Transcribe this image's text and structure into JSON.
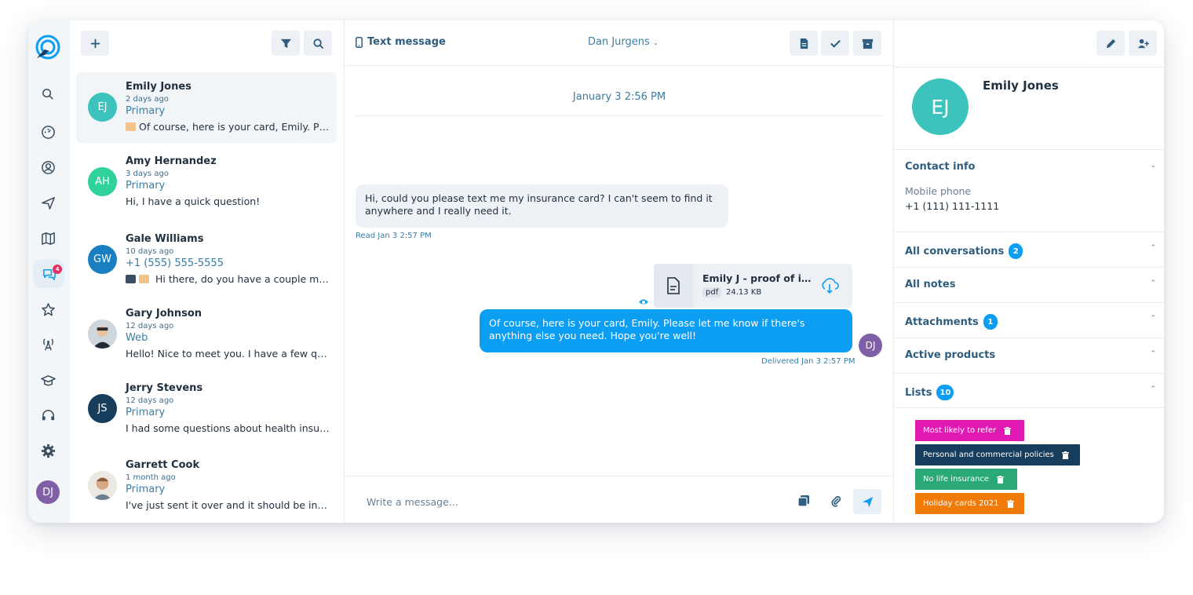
{
  "rail": {
    "items": [
      {
        "icon": "search-icon"
      },
      {
        "icon": "dashboard-icon"
      },
      {
        "icon": "contact-icon"
      },
      {
        "icon": "send-icon"
      },
      {
        "icon": "map-icon"
      },
      {
        "icon": "chat-icon",
        "badge": "4"
      },
      {
        "icon": "star-icon"
      },
      {
        "icon": "broadcast-icon"
      },
      {
        "icon": "graduation-cap-icon"
      },
      {
        "icon": "headset-icon"
      },
      {
        "icon": "gear-icon"
      }
    ],
    "user_initials": "DJ"
  },
  "conversations": [
    {
      "name": "Emily Jones",
      "initials": "EJ",
      "color": "#3cc3bd",
      "time": "2 days ago",
      "channel": "Primary",
      "preview": "Of course, here is your card, Emily. Please let me know if there's anything else you need."
    },
    {
      "name": "Amy Hernandez",
      "initials": "AH",
      "color": "#2fd39a",
      "time": "3 days ago",
      "channel": "Primary",
      "preview": "Hi, I have a quick question!"
    },
    {
      "name": "Gale Williams",
      "initials": "GW",
      "color": "#1a7fc1",
      "time": "10 days ago",
      "channel": "+1 (555) 555-5555",
      "preview": "Hi there, do you have a couple minutes to talk?"
    },
    {
      "name": "Gary Johnson",
      "initials": "",
      "color": "#8a96a3",
      "time": "12 days ago",
      "channel": "Web",
      "preview": "Hello! Nice to meet you. I have a few  questions about my policy."
    },
    {
      "name": "Jerry Stevens",
      "initials": "JS",
      "color": "#163d5c",
      "time": "12 days ago",
      "channel": "Primary",
      "preview": "I had some questions about health insurance coverage."
    },
    {
      "name": "Garrett Cook",
      "initials": "",
      "color": "#c89b7b",
      "time": "1 month ago",
      "channel": "Primary",
      "preview": "I've just sent it over and it should be in your inbox."
    }
  ],
  "chat": {
    "channel_label": "Text message",
    "agent": "Dan Jurgens",
    "date_separator": "January 3 2:56 PM",
    "incoming_text": "Hi, could you please text me my insurance card? I can't seem to find it anywhere and I really need it.",
    "incoming_meta": "Read Jan 3 2:57 PM",
    "attachment_name": "Emily J - proof of insurance",
    "attachment_ext": "pdf",
    "attachment_size": "24.13 KB",
    "outgoing_text": "Of course, here is your card, Emily. Please let me know if there's anything else you need. Hope you're well!",
    "outgoing_meta": "Delivered Jan 3 2:57 PM",
    "outgoing_initials": "DJ",
    "composer_placeholder": "Write a message..."
  },
  "contact": {
    "initials": "EJ",
    "name": "Emily Jones",
    "contact_info_title": "Contact info",
    "phone_label": "Mobile phone",
    "phone_value": "+1 (111) 111-1111",
    "sections": [
      {
        "title": "All conversations",
        "count": "2"
      },
      {
        "title": "All notes",
        "count": ""
      },
      {
        "title": "Attachments",
        "count": "1"
      },
      {
        "title": "Active products",
        "count": ""
      },
      {
        "title": "Lists",
        "count": "10"
      }
    ],
    "tags": [
      {
        "label": "Most likely to refer",
        "color": "#e019b2"
      },
      {
        "label": "Personal and commercial policies",
        "color": "#163d5c"
      },
      {
        "label": "No life insurance",
        "color": "#2aa876"
      },
      {
        "label": "Holiday cards 2021",
        "color": "#f07b0a"
      }
    ]
  },
  "colors": {
    "accent": "#0b9ef3",
    "primary_text": "#2f5d7e",
    "badge": "#e63262"
  }
}
